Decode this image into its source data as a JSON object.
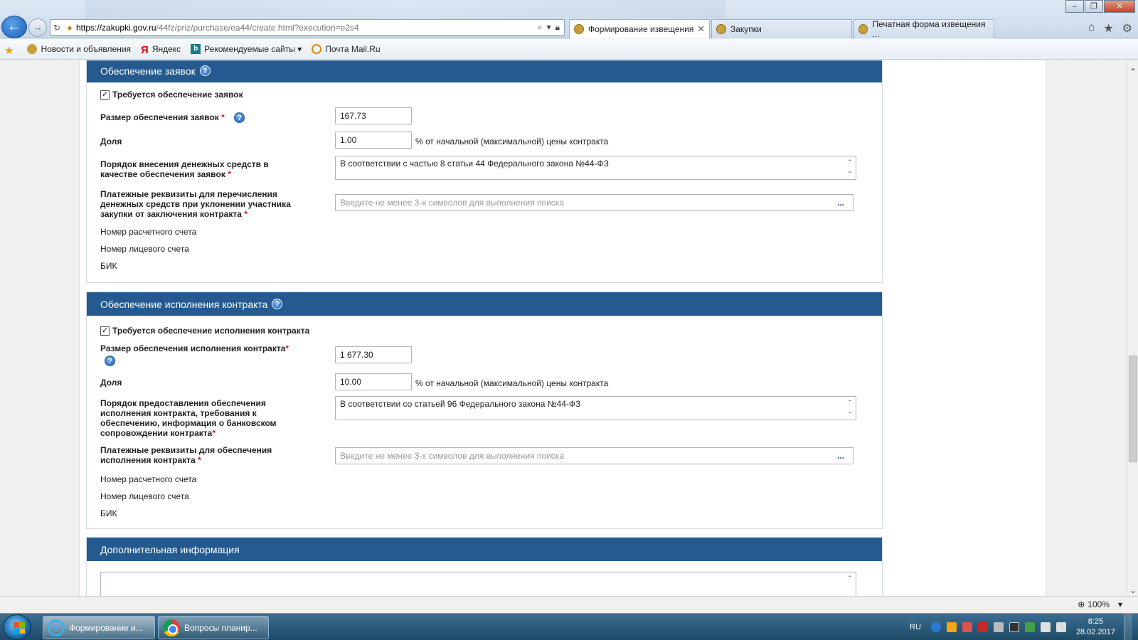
{
  "browser": {
    "url_host": "https://zakupki.gov.ru",
    "url_path": "/44fz/priz/purchase/ea44/create.html?execution=e2s4",
    "tabs": [
      {
        "label": "Формирование извещения",
        "active": true
      },
      {
        "label": "Закупки",
        "active": false
      },
      {
        "label": "Печатная форма извещения ...",
        "active": false
      }
    ],
    "favorites": [
      {
        "label": "Новости и объявления",
        "icon": "emblem-icon"
      },
      {
        "label": "Яндекс",
        "icon": "yandex-icon"
      },
      {
        "label": "Рекомендуемые сайты ▾",
        "icon": "bing-icon"
      },
      {
        "label": "Почта Mail.Ru",
        "icon": "mail-icon"
      }
    ],
    "zoom": "100%"
  },
  "section1": {
    "title": "Обеспечение заявок",
    "checkbox_label": "Требуется обеспечение заявок",
    "size_label": "Размер обеспечения заявок",
    "size_value": "167.73",
    "share_label": "Доля",
    "share_value": "1.00",
    "share_suffix": "% от начальной (максимальной) цены контракта",
    "order_label_1": "Порядок внесения денежных средств в",
    "order_label_2": "качестве обеспечения заявок",
    "order_value": "В соответствии с частью 8 статьи 44 Федерального закона №44-ФЗ",
    "payment_label_1": "Платежные реквизиты для перечисления",
    "payment_label_2": "денежных средств при уклонении участника",
    "payment_label_3": "закупки от заключения контракта",
    "payment_placeholder": "Введите не менее 3-х символов для выполнения поиска",
    "account_label": "Номер расчетного счета",
    "personal_account_label": "Номер лицевого счета",
    "bik_label": "БИК"
  },
  "section2": {
    "title": "Обеспечение исполнения контракта",
    "checkbox_label": "Требуется обеспечение исполнения контракта",
    "size_label": "Размер обеспечения исполнения контракта",
    "size_value": "1 677.30",
    "share_label": "Доля",
    "share_value": "10.00",
    "share_suffix": "% от начальной (максимальной) цены контракта",
    "order_label_1": "Порядок предоставления обеспечения",
    "order_label_2": "исполнения контракта, требования к",
    "order_label_3": "обеспечению, информация о банковском",
    "order_label_4": "сопровождении контракта",
    "order_value": "В соответствии со статьей 96 Федерального закона №44-ФЗ",
    "payment_label_1": "Платежные реквизиты для обеспечения",
    "payment_label_2": "исполнения контракта",
    "payment_placeholder": "Введите не менее 3-х символов для выполнения поиска",
    "account_label": "Номер расчетного счета",
    "personal_account_label": "Номер лицевого счета",
    "bik_label": "БИК"
  },
  "section3": {
    "title": "Дополнительная информация"
  },
  "taskbar": {
    "items": [
      {
        "label": "Формирование и...",
        "app": "ie"
      },
      {
        "label": "Вопросы планир...",
        "app": "chrome"
      }
    ],
    "lang": "RU",
    "time": "8:25",
    "date": "28.02.2017"
  },
  "colors": {
    "header_bg": "#245a8f",
    "required": "#d21f1f"
  }
}
